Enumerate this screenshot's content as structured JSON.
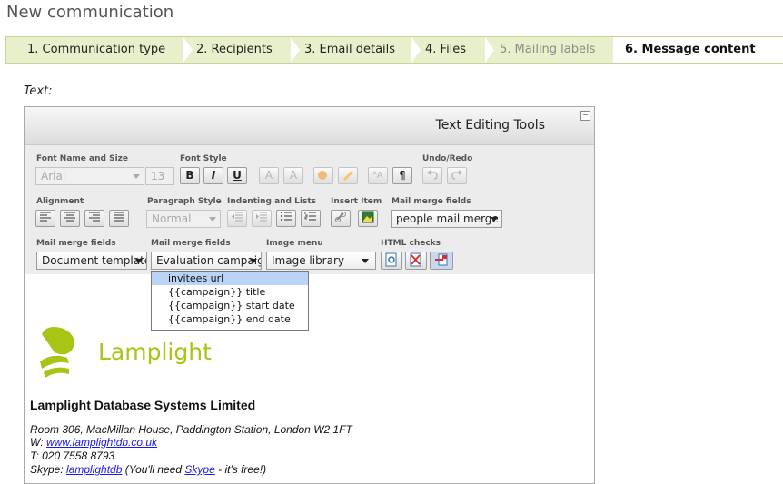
{
  "page": {
    "title": "New communication"
  },
  "wizard": {
    "steps": [
      {
        "label": "1. Communication type",
        "state": "done"
      },
      {
        "label": "2. Recipients",
        "state": "done"
      },
      {
        "label": "3. Email details",
        "state": "done"
      },
      {
        "label": "4. Files",
        "state": "done"
      },
      {
        "label": "5. Mailing labels",
        "state": "disabled"
      },
      {
        "label": "6. Message content",
        "state": "active"
      }
    ]
  },
  "field_label": "Text:",
  "editor": {
    "title": "Text Editing Tools",
    "collapse": "−",
    "groups": {
      "font_name_size": "Font Name and Size",
      "font_style": "Font Style",
      "undo_redo": "Undo/Redo",
      "alignment": "Alignment",
      "paragraph_style": "Paragraph Style",
      "indenting": "Indenting and Lists",
      "insert_item": "Insert Item",
      "mail_merge_1": "Mail merge fields",
      "mail_merge_2": "Mail merge fields",
      "mail_merge_3": "Mail merge fields",
      "image_menu": "Image menu",
      "html_checks": "HTML checks"
    },
    "font_name": "Arial",
    "font_size": "13",
    "bold": "B",
    "italic": "I",
    "underline": "U",
    "subscript": "A",
    "superscript": "A",
    "paragraph_mark": "¶",
    "paragraph_style_value": "Normal",
    "people_merge_value": "people mail merge",
    "document_templates_value": "Document templates",
    "evaluation_campaign_value": "Evaluation campaign",
    "image_library_value": "Image library"
  },
  "dropdown": {
    "items": [
      {
        "label": "invitees url",
        "selected": true
      },
      {
        "label": "{{campaign}} title",
        "selected": false
      },
      {
        "label": "{{campaign}} start date",
        "selected": false
      },
      {
        "label": "{{campaign}} end date",
        "selected": false
      }
    ]
  },
  "content": {
    "logo_text": "Lamplight",
    "company": "Lamplight Database Systems Limited",
    "address": "Room 306, MacMillan House, Paddington Station, London W2 1FT",
    "web_prefix": "W: ",
    "web_link": "www.lamplightdb.co.uk ",
    "phone": "T: 020 7558 8793",
    "skype_prefix": "Skype: ",
    "skype_link": "lamplightdb",
    "skype_middle": " (You'll need ",
    "skype_link2": "Skype",
    "skype_suffix": " - it's free!)"
  },
  "colors": {
    "steps_bg": "#e8efcb",
    "logo_green": "#a8c515",
    "link": "#1a1aee",
    "dropdown_selected": "#b9d4f5"
  }
}
